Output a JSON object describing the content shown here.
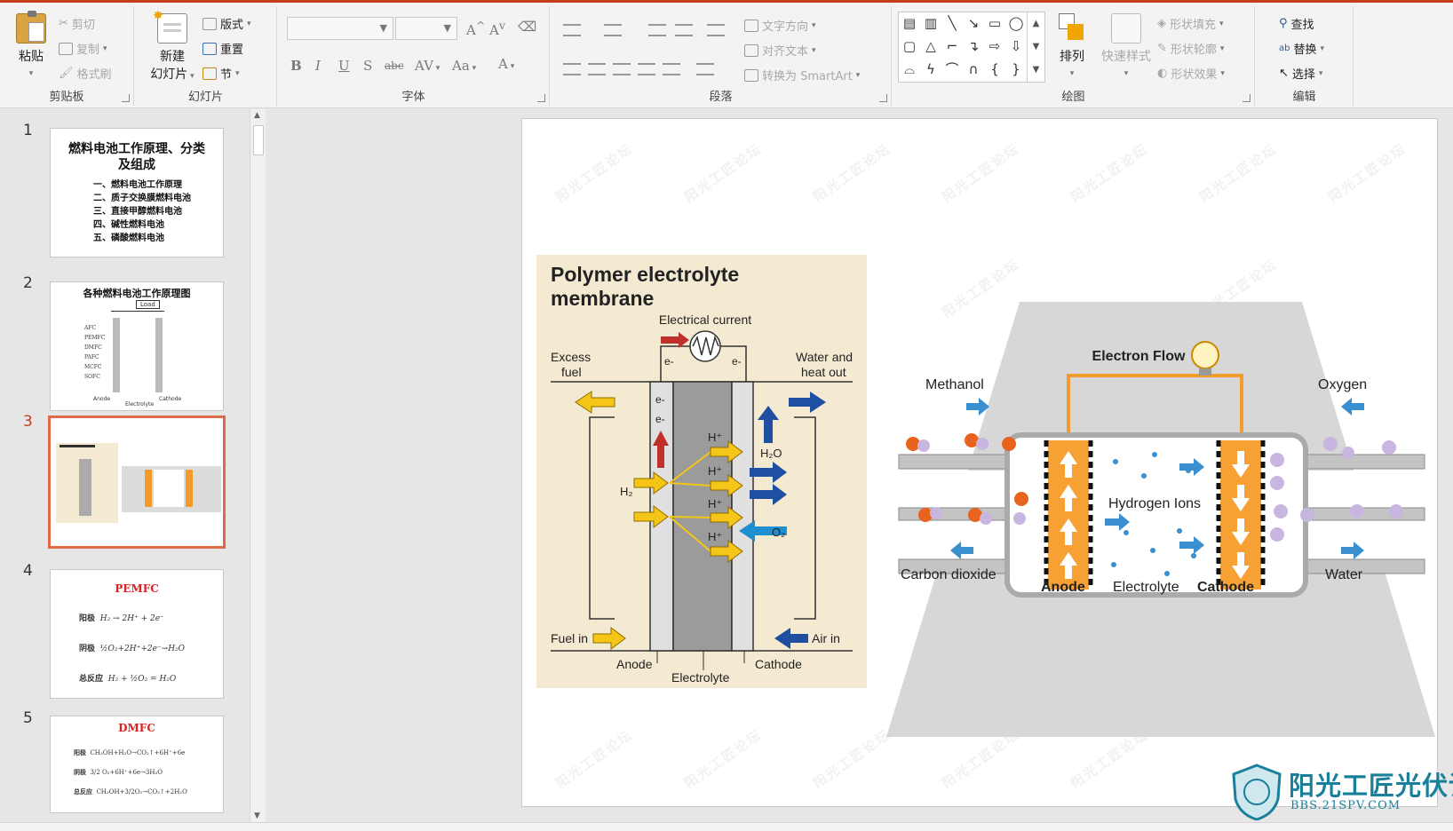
{
  "ribbon": {
    "clipboard": {
      "label": "剪贴板",
      "paste": "粘贴",
      "cut": "剪切",
      "copy": "复制",
      "format_painter": "格式刷"
    },
    "slides": {
      "label": "幻灯片",
      "new_slide_1": "新建",
      "new_slide_2": "幻灯片",
      "layout": "版式",
      "reset": "重置",
      "section": "节"
    },
    "font": {
      "label": "字体",
      "bold": "B",
      "italic": "I",
      "underline": "U",
      "shadow": "S",
      "strike": "abc",
      "spacing": "AV",
      "case": "Aa",
      "grow": "A",
      "shrink": "A",
      "color": "A"
    },
    "paragraph": {
      "label": "段落",
      "text_direction": "文字方向",
      "align_text": "对齐文本",
      "smartart": "转换为 SmartArt"
    },
    "drawing": {
      "label": "绘图",
      "arrange": "排列",
      "quick_styles": "快速样式",
      "shape_fill": "形状填充",
      "shape_outline": "形状轮廓",
      "shape_effects": "形状效果"
    },
    "editing": {
      "label": "编辑",
      "find": "查找",
      "replace": "替换",
      "select": "选择"
    }
  },
  "thumbnails": [
    {
      "num": "1",
      "title": "燃料电池工作原理、分类及组成",
      "lines": [
        "一、燃料电池工作原理",
        "二、质子交换膜燃料电池",
        "三、直接甲醇燃料电池",
        "四、碱性燃料电池",
        "五、磷酸燃料电池"
      ]
    },
    {
      "num": "2",
      "title": "各种燃料电池工作原理图",
      "rows": [
        "AFC",
        "PEMFC",
        "DMFC",
        "PAFC",
        "MCFC",
        "SOFC"
      ],
      "load": "Load",
      "anode": "Anode",
      "electrolyte": "Electrolyte",
      "cathode": "Cathode"
    },
    {
      "num": "3"
    },
    {
      "num": "4",
      "title": "PEMFC",
      "eq_labels": [
        "阳极",
        "阴极",
        "总反应"
      ],
      "eqs": [
        "H₂ → 2H⁺ + 2e⁻",
        "½O₂+2H⁺+2e⁻→H₂O",
        "H₂ + ½O₂ = H₂O"
      ]
    },
    {
      "num": "5",
      "title": "DMFC",
      "eq_labels": [
        "阳极",
        "阴极",
        "总反应"
      ],
      "eqs": [
        "CH₃OH+H₂O→CO₂↑+6H⁺+6e",
        "3/2 O₂+6H⁺+6e→3H₂O",
        "CH₃OH+3/2O₂→CO₂↑+2H₂O"
      ]
    }
  ],
  "slide": {
    "left_figure": {
      "title_line1": "Polymer electrolyte",
      "title_line2": "membrane",
      "electrical_current": "Electrical current",
      "excess_fuel_1": "Excess",
      "excess_fuel_2": "fuel",
      "water_heat_1": "Water and",
      "water_heat_2": "heat out",
      "h2": "H₂",
      "h2o": "H₂O",
      "o2": "O₂",
      "hplus": "H⁺",
      "eminus": "e-",
      "fuel_in": "Fuel in",
      "air_in": "Air in",
      "anode": "Anode",
      "electrolyte": "Electrolyte",
      "cathode": "Cathode"
    },
    "right_figure": {
      "electron_flow": "Electron Flow",
      "methanol": "Methanol",
      "oxygen": "Oxygen",
      "hydrogen_ions": "Hydrogen Ions",
      "carbon_dioxide": "Carbon dioxide",
      "water": "Water",
      "anode": "Anode",
      "electrolyte": "Electrolyte",
      "cathode": "Cathode"
    }
  },
  "watermark": "阳光工匠论坛",
  "logo": {
    "brand": "阳光工匠光伏论坛",
    "url": "BBS.21SPV.COM"
  },
  "colors": {
    "accent": "#c43e1c",
    "arrow_yellow": "#f5c518",
    "arrow_blue": "#1e4fa0",
    "orange": "#f39a2c",
    "teal": "#1a7f9a"
  }
}
